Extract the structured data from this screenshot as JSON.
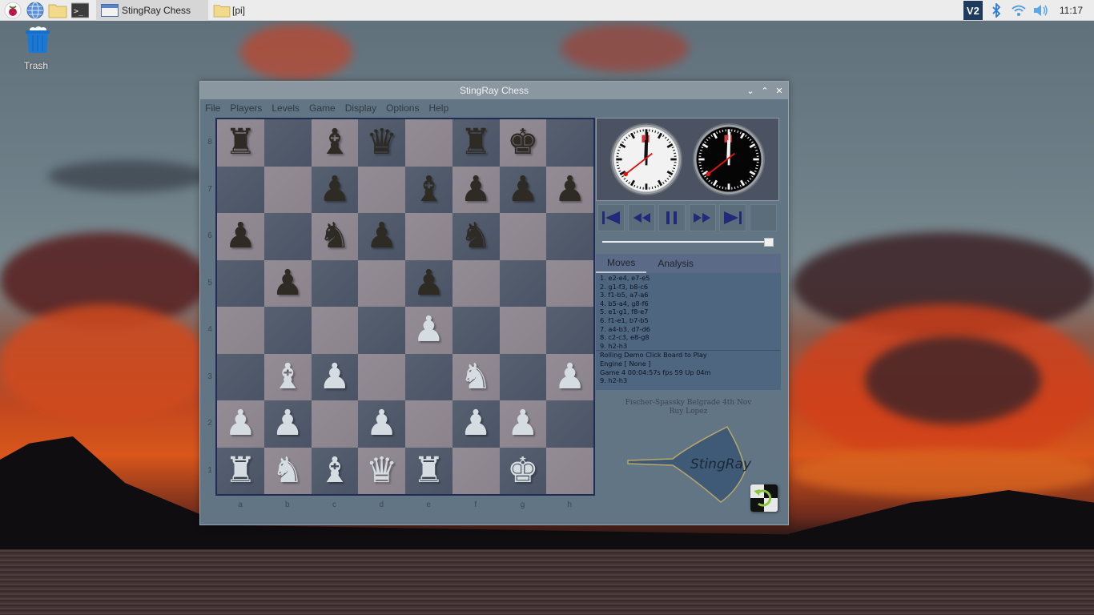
{
  "taskbar": {
    "launchers": [
      {
        "name": "raspberry-menu",
        "icon": "raspberry-icon"
      },
      {
        "name": "web-browser",
        "icon": "globe-icon"
      },
      {
        "name": "file-manager",
        "icon": "folder-icon"
      },
      {
        "name": "terminal",
        "icon": "terminal-icon"
      }
    ],
    "tasks": [
      {
        "label": "StingRay Chess",
        "active": true
      },
      {
        "label": "[pi]",
        "active": false
      }
    ],
    "tray": {
      "vnc_label": "V2",
      "time": "11:17"
    }
  },
  "desktop": {
    "icons": [
      {
        "label": "Trash",
        "icon": "trash-icon"
      }
    ]
  },
  "window": {
    "title": "StingRay Chess",
    "controls": [
      "minimize",
      "maximize",
      "close"
    ],
    "menu": [
      "File",
      "Players",
      "Levels",
      "Game",
      "Display",
      "Options",
      "Help"
    ]
  },
  "board": {
    "ranks": [
      "8",
      "7",
      "6",
      "5",
      "4",
      "3",
      "2",
      "1"
    ],
    "files": [
      "a",
      "b",
      "c",
      "d",
      "e",
      "f",
      "g",
      "h"
    ],
    "position": [
      [
        "r",
        "",
        "b",
        "q",
        "",
        "r",
        "k",
        ""
      ],
      [
        "",
        "",
        "p",
        "",
        "b",
        "p",
        "p",
        "p"
      ],
      [
        "p",
        "",
        "n",
        "p",
        "",
        "n",
        "",
        ""
      ],
      [
        "",
        "p",
        "",
        "",
        "p",
        "",
        "",
        ""
      ],
      [
        "",
        "",
        "",
        "",
        "P",
        "",
        "",
        ""
      ],
      [
        "",
        "B",
        "P",
        "",
        "",
        "N",
        "",
        "P"
      ],
      [
        "P",
        "P",
        "",
        "P",
        "",
        "P",
        "P",
        ""
      ],
      [
        "R",
        "N",
        "B",
        "Q",
        "R",
        "",
        "K",
        ""
      ]
    ]
  },
  "clocks": {
    "white": {
      "hour_hand": "12",
      "minute_hand": "00",
      "second_hand": "~38s"
    },
    "black": {
      "hour_hand": "12",
      "minute_hand": "00",
      "second_hand": "~38s"
    }
  },
  "transport": [
    {
      "name": "first-move",
      "glyph": "⏮"
    },
    {
      "name": "previous-move",
      "glyph": "⏪"
    },
    {
      "name": "pause",
      "glyph": "⏸"
    },
    {
      "name": "next-move",
      "glyph": "⏩"
    },
    {
      "name": "last-move",
      "glyph": "⏭"
    },
    {
      "name": "blank",
      "glyph": ""
    }
  ],
  "slider": {
    "value_percent": 100
  },
  "tabs": [
    {
      "label": "Moves",
      "active": true
    },
    {
      "label": "Analysis",
      "active": false
    }
  ],
  "moves": [
    "1. e2-e4, e7-e5",
    "2. g1-f3, b8-c6",
    "3. f1-b5, a7-a6",
    "4. b5-a4, g8-f6",
    "5. e1-g1, f8-e7",
    "6. f1-e1, b7-b5",
    "7. a4-b3, d7-d6",
    "8. c2-c3, e8-g8",
    "9. h2-h3"
  ],
  "status": [
    "Rolling Demo Click Board to Play",
    "Engine [ None ]",
    "Game 4 00:04:57s fps 59 Up 04m",
    "9.  h2-h3"
  ],
  "game_info": {
    "line1": "Fischer-Spassky Belgrade 4th Nov",
    "line2": "Ruy Lopez"
  },
  "logo": {
    "text": "StingRay"
  },
  "colors": {
    "light_square": "#8f8891",
    "dark_square": "#515b6b",
    "window_bg": "#627584",
    "moves_bg": "#4e6680",
    "black_piece": "#2d2b24",
    "white_piece": "#d6dde2"
  }
}
